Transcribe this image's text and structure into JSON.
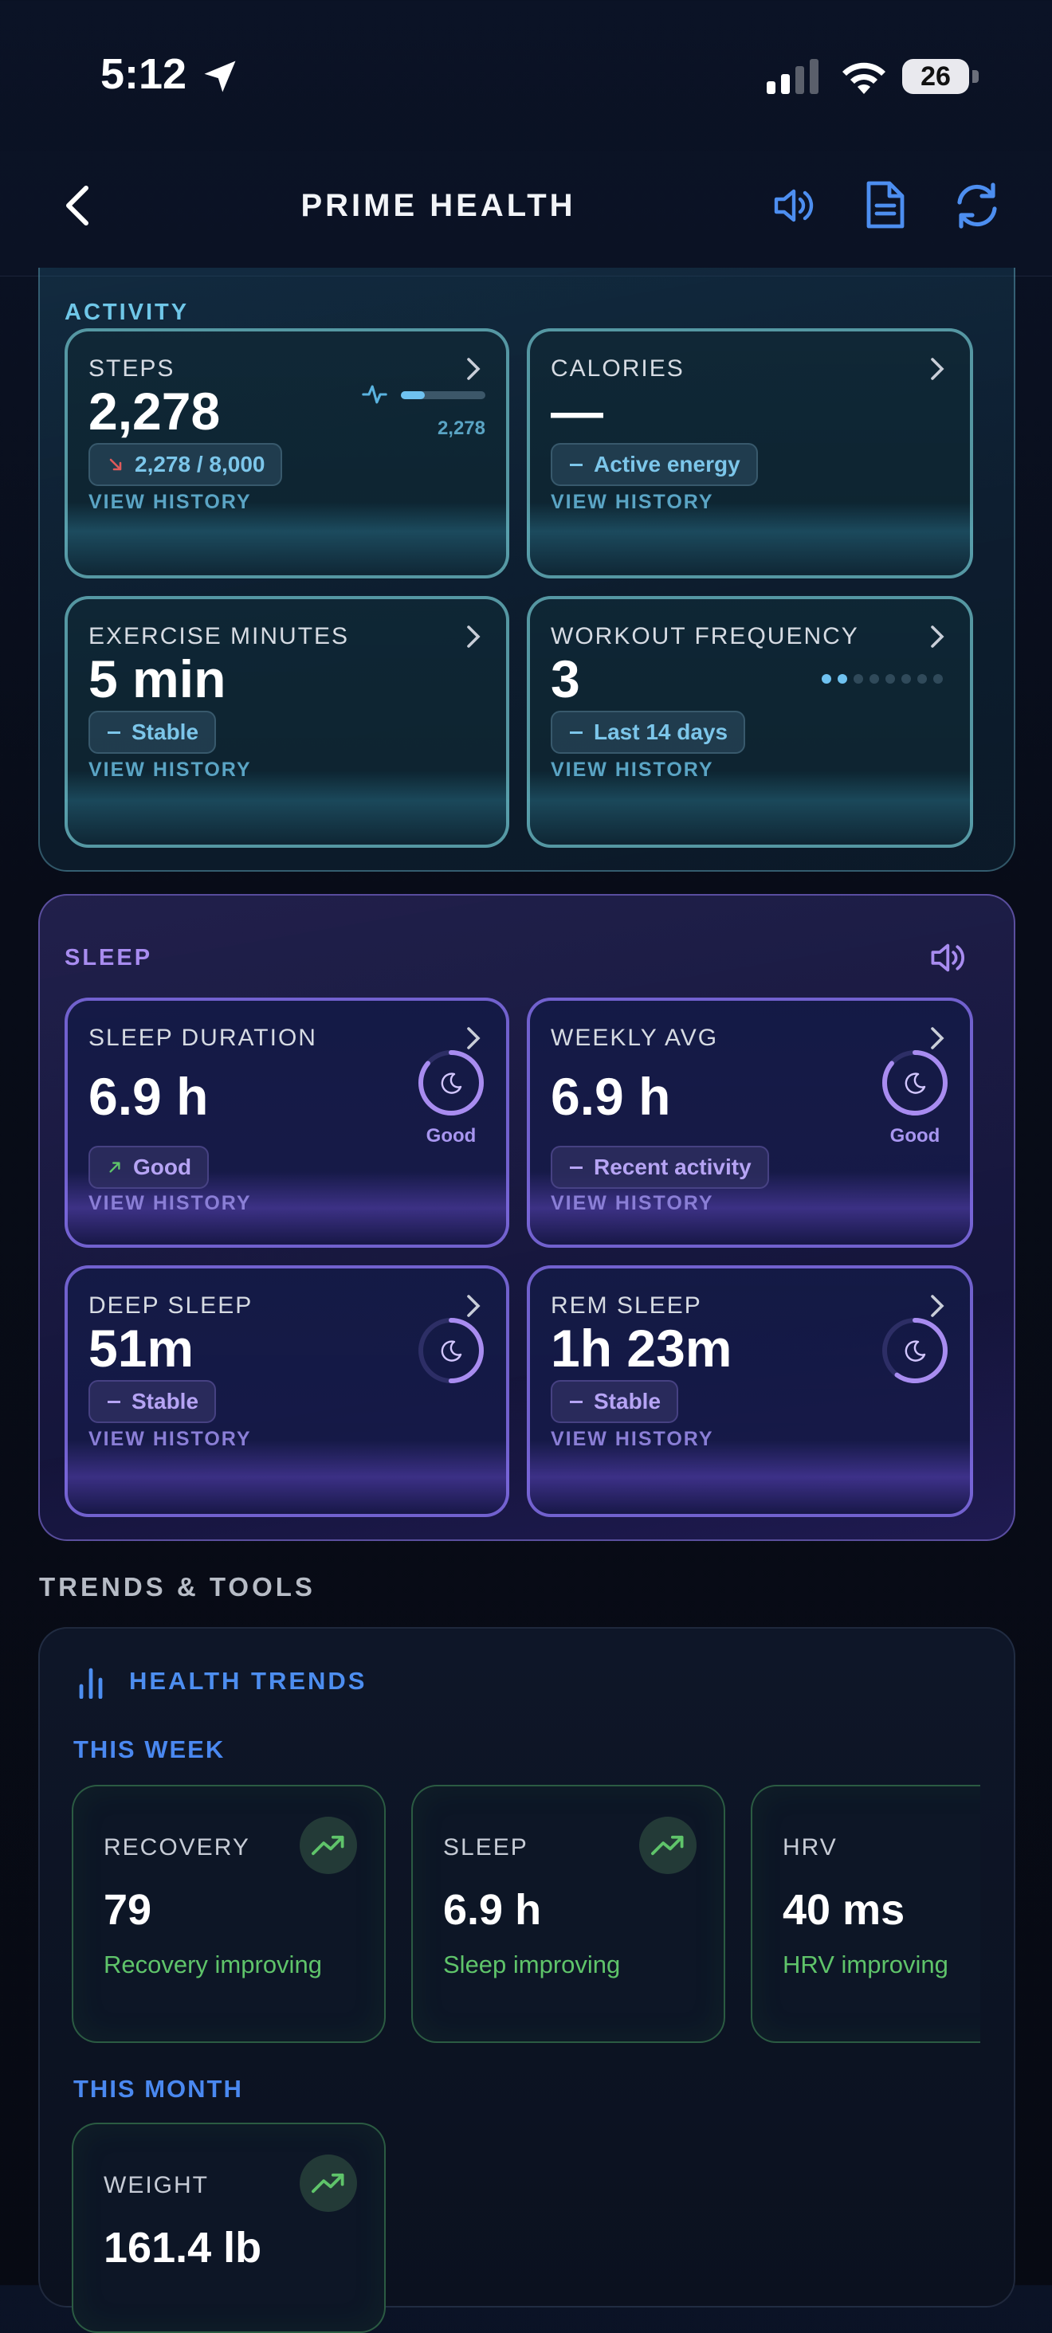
{
  "status_bar": {
    "time": "5:12",
    "battery": "26"
  },
  "header": {
    "title": "PRIME HEALTH"
  },
  "activity": {
    "label": "ACTIVITY",
    "steps": {
      "label": "STEPS",
      "value": "2,278",
      "badge": "2,278 / 8,000",
      "mini_value": "2,278",
      "progress": 0.28,
      "history": "VIEW HISTORY"
    },
    "calories": {
      "label": "CALORIES",
      "value": "—",
      "badge": "Active energy",
      "history": "VIEW HISTORY"
    },
    "exercise": {
      "label": "EXERCISE MINUTES",
      "value": "5 min",
      "badge": "Stable",
      "history": "VIEW HISTORY"
    },
    "workout": {
      "label": "WORKOUT FREQUENCY",
      "value": "3",
      "badge": "Last 14 days",
      "history": "VIEW HISTORY",
      "dots_filled": 2,
      "dots_total": 8
    }
  },
  "sleep": {
    "label": "SLEEP",
    "duration": {
      "label": "SLEEP DURATION",
      "value": "6.9 h",
      "ring_label": "Good",
      "badge": "Good",
      "history": "VIEW HISTORY",
      "ring_fraction": 0.86
    },
    "weekly": {
      "label": "WEEKLY AVG",
      "value": "6.9 h",
      "ring_label": "Good",
      "badge": "Recent activity",
      "history": "VIEW HISTORY",
      "ring_fraction": 0.86
    },
    "deep": {
      "label": "DEEP SLEEP",
      "value": "51m",
      "badge": "Stable",
      "history": "VIEW HISTORY",
      "ring_fraction": 0.5
    },
    "rem": {
      "label": "REM SLEEP",
      "value": "1h 23m",
      "badge": "Stable",
      "history": "VIEW HISTORY",
      "ring_fraction": 0.6
    }
  },
  "trends": {
    "heading": "TRENDS & TOOLS",
    "panel_title": "HEALTH TRENDS",
    "this_week": "THIS WEEK",
    "this_month": "THIS MONTH",
    "week_cards": [
      {
        "label": "RECOVERY",
        "value": "79",
        "sub": "Recovery improving"
      },
      {
        "label": "SLEEP",
        "value": "6.9 h",
        "sub": "Sleep improving"
      },
      {
        "label": "HRV",
        "value": "40 ms",
        "sub": "HRV improving"
      }
    ],
    "month_cards": [
      {
        "label": "WEIGHT",
        "value": "161.4 lb"
      }
    ]
  },
  "colors": {
    "accent_blue": "#4a88f0",
    "cyan": "#6fc7e8",
    "purple": "#a88cf0",
    "green": "#5fc46a"
  }
}
